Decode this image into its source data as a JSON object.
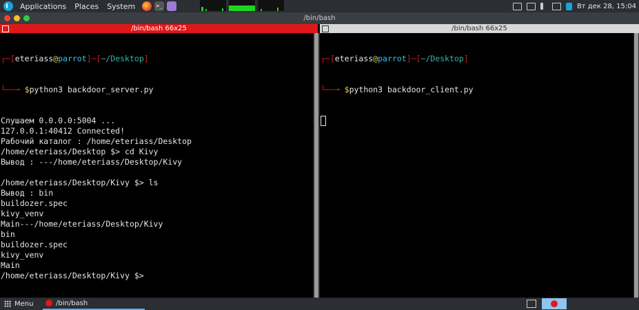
{
  "top_panel": {
    "menu": [
      "Applications",
      "Places",
      "System"
    ],
    "launchers": [
      "firefox-icon",
      "terminal-icon",
      "text-editor-icon"
    ],
    "clock": "Вт дек 28, 15:04"
  },
  "window": {
    "title": "/bin/bash"
  },
  "panes": {
    "left": {
      "title": "/bin/bash 66x25",
      "prompt": {
        "user": "eteriass",
        "host": "parrot",
        "path": "~/Desktop",
        "command": "python3 backdoor_server.py"
      },
      "output": [
        "Слушаем 0.0.0.0:5004 ...",
        "127.0.0.1:40412 Connected!",
        "Рабочий каталог : /home/eteriass/Desktop",
        "/home/eteriass/Desktop $> cd Kivy",
        "Вывод : ---/home/eteriass/Desktop/Kivy",
        "",
        "/home/eteriass/Desktop/Kivy $> ls",
        "Вывод : bin",
        "buildozer.spec",
        "kivy_venv",
        "Main---/home/eteriass/Desktop/Kivy",
        "bin",
        "buildozer.spec",
        "kivy_venv",
        "Main",
        "/home/eteriass/Desktop/Kivy $>"
      ]
    },
    "right": {
      "title": "/bin/bash 66x25",
      "prompt": {
        "user": "eteriass",
        "host": "parrot",
        "path": "~/Desktop",
        "command": "python3 backdoor_client.py"
      }
    }
  },
  "bottom_panel": {
    "menu_label": "Menu",
    "task_label": "/bin/bash"
  },
  "colors": {
    "active_pane": "#e01818",
    "inactive_pane": "#d8d8d8",
    "panel_bg": "#2b2e33"
  }
}
